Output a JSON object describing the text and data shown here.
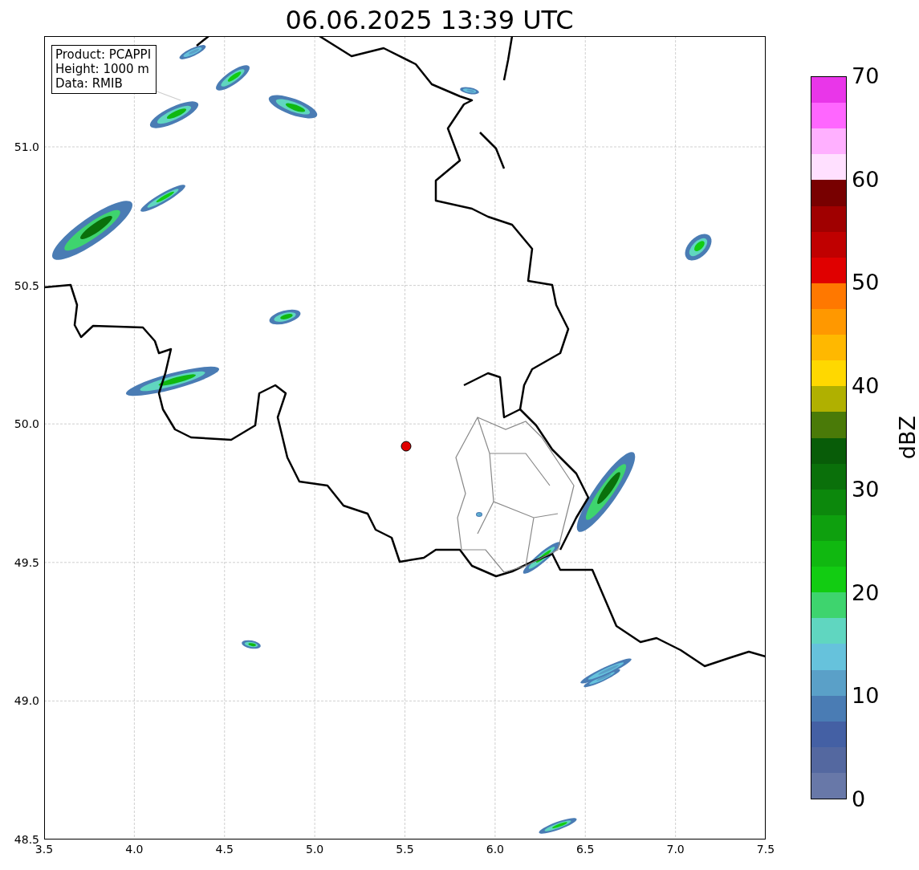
{
  "title": "06.06.2025 13:39 UTC",
  "info_box": [
    "Product: PCAPPI",
    "Height: 1000 m",
    "Data: RMIB"
  ],
  "x_ticks": [
    "3.5",
    "4.0",
    "4.5",
    "5.0",
    "5.5",
    "6.0",
    "6.5",
    "7.0",
    "7.5"
  ],
  "y_ticks": [
    "51.0",
    "50.5",
    "50.0",
    "49.5",
    "49.0",
    "48.5"
  ],
  "colorbar": {
    "label": "dBZ",
    "ticks": [
      "70",
      "60",
      "50",
      "40",
      "30",
      "20",
      "10",
      "0"
    ],
    "levels": [
      {
        "color": "#6878a8"
      },
      {
        "color": "#5468a0"
      },
      {
        "color": "#4460a4"
      },
      {
        "color": "#4a7cb4"
      },
      {
        "color": "#5aa0c8"
      },
      {
        "color": "#66c2dc"
      },
      {
        "color": "#60d6c0"
      },
      {
        "color": "#3ed46e"
      },
      {
        "color": "#12cc12"
      },
      {
        "color": "#10b810"
      },
      {
        "color": "#0ea00e"
      },
      {
        "color": "#0c880c"
      },
      {
        "color": "#0a700a"
      },
      {
        "color": "#085c08"
      },
      {
        "color": "#4a7a08"
      },
      {
        "color": "#b0b000"
      },
      {
        "color": "#ffd800"
      },
      {
        "color": "#ffb800"
      },
      {
        "color": "#ff9800"
      },
      {
        "color": "#ff7800"
      },
      {
        "color": "#e00000"
      },
      {
        "color": "#c00000"
      },
      {
        "color": "#a00000"
      },
      {
        "color": "#780000"
      },
      {
        "color": "#ffe0ff"
      },
      {
        "color": "#ffb0ff"
      },
      {
        "color": "#ff66ff"
      },
      {
        "color": "#e936e9"
      }
    ]
  }
}
